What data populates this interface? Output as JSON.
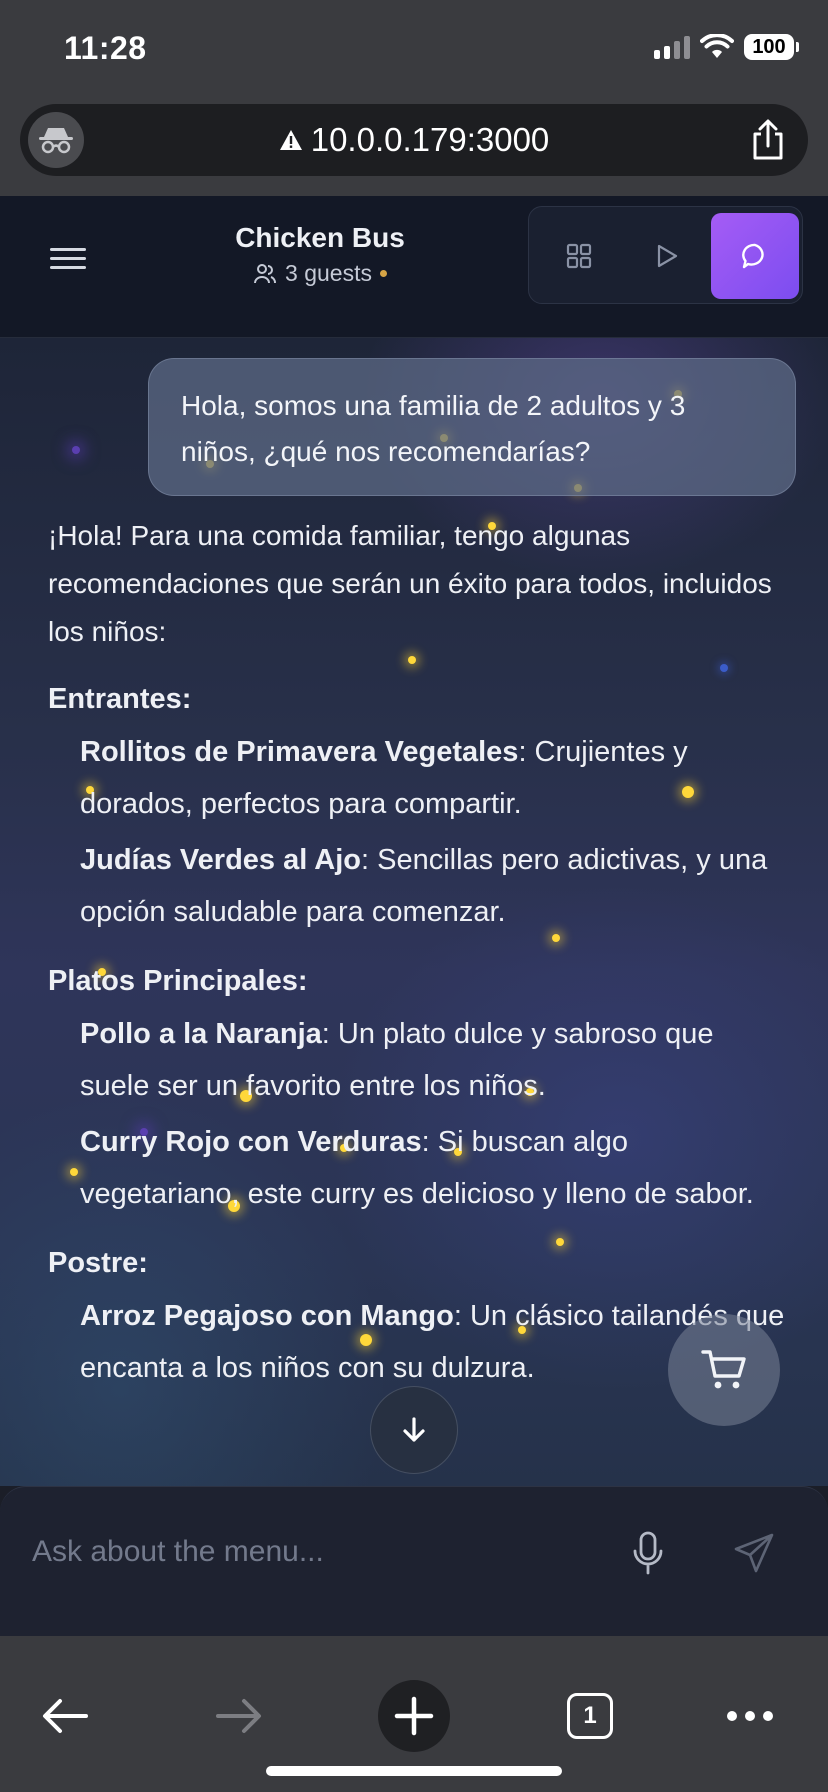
{
  "status_bar": {
    "time": "11:28",
    "battery": "100"
  },
  "browser": {
    "url": "10.0.0.179:3000",
    "tab_count": "1"
  },
  "header": {
    "title": "Chicken Bus",
    "guests": "3 guests"
  },
  "chat": {
    "user_message": "Hola, somos una familia de 2 adultos y 3 niños, ¿qué nos recomendarías?",
    "assistant": {
      "intro": "¡Hola! Para una comida familiar, tengo algunas recomendaciones que serán un éxito para todos, incluidos los niños:",
      "sections": [
        {
          "title": "Entrantes:",
          "items": [
            {
              "name": "Rollitos de Primavera Vegetales",
              "desc": ": Crujientes y dorados, perfectos para compartir."
            },
            {
              "name": "Judías Verdes al Ajo",
              "desc": ": Sencillas pero adictivas, y una opción saludable para comenzar."
            }
          ]
        },
        {
          "title": "Platos Principales:",
          "items": [
            {
              "name": "Pollo a la Naranja",
              "desc": ": Un plato dulce y sabroso que suele ser un favorito entre los niños."
            },
            {
              "name": "Curry Rojo con Verduras",
              "desc": ": Si buscan algo vegetariano, este curry es delicioso y lleno de sabor."
            }
          ]
        },
        {
          "title": "Postre:",
          "items": [
            {
              "name": "Arroz Pegajoso con Mango",
              "desc": ": Un clásico tailandés que encanta a los niños con su dulzura."
            }
          ]
        }
      ]
    }
  },
  "composer": {
    "placeholder": "Ask about the menu..."
  },
  "icons": {
    "incognito": "incognito-icon",
    "warning": "warning-icon",
    "share": "share-icon",
    "menu": "hamburger-icon",
    "guests": "users-icon",
    "grid": "grid-icon",
    "play": "play-icon",
    "chat": "chat-bubble-icon",
    "cart": "cart-icon",
    "scroll_down": "arrow-down-icon",
    "mic": "microphone-icon",
    "send": "send-icon",
    "back": "arrow-left-icon",
    "forward": "arrow-right-icon",
    "new_tab": "plus-icon",
    "more": "ellipsis-icon"
  },
  "colors": {
    "accent": "#8b55f3",
    "guest_dot": "#d6a446",
    "sparkle": "#ffd83a"
  }
}
